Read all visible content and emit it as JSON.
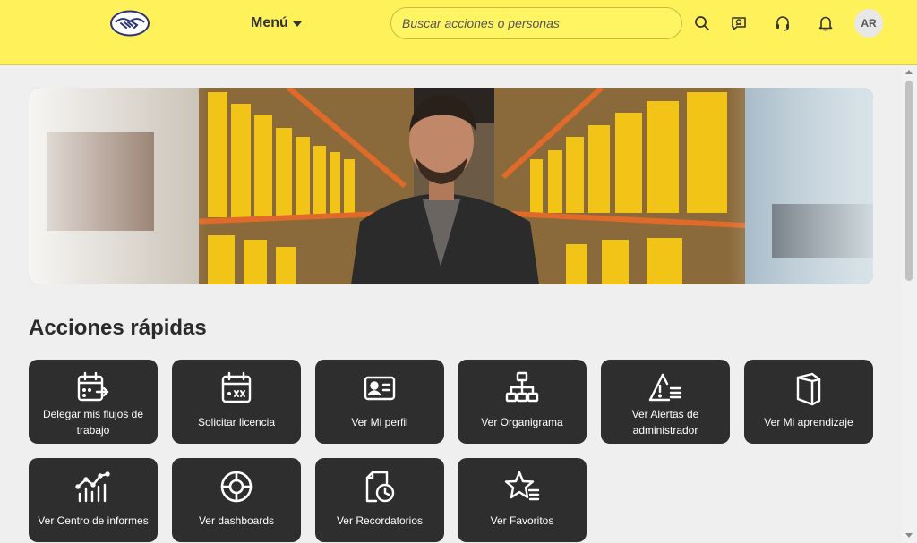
{
  "header": {
    "menu_label": "Menú",
    "search_placeholder": "Buscar acciones o personas",
    "avatar_initials": "AR",
    "icons": [
      "search-icon",
      "chat-bot-icon",
      "headset-icon",
      "bell-icon"
    ],
    "brand_color": "#fff15a"
  },
  "quick_actions": {
    "title": "Acciones rápidas",
    "tiles": [
      {
        "label": "Delegar mis flujos de trabajo",
        "icon": "calendar-forward-icon"
      },
      {
        "label": "Solicitar licencia",
        "icon": "calendar-cancel-icon"
      },
      {
        "label": "Ver Mi perfil",
        "icon": "id-card-icon"
      },
      {
        "label": "Ver Organigrama",
        "icon": "org-chart-icon"
      },
      {
        "label": "Ver Alertas de administrador",
        "icon": "alert-list-icon"
      },
      {
        "label": "Ver Mi aprendizaje",
        "icon": "book-icon"
      },
      {
        "label": "Ver Centro de informes",
        "icon": "analytics-icon"
      },
      {
        "label": "Ver dashboards",
        "icon": "target-icon"
      },
      {
        "label": "Ver Recordatorios",
        "icon": "document-clock-icon"
      },
      {
        "label": "Ver Favoritos",
        "icon": "star-list-icon"
      }
    ],
    "tile_color": "#2e2e2e"
  }
}
